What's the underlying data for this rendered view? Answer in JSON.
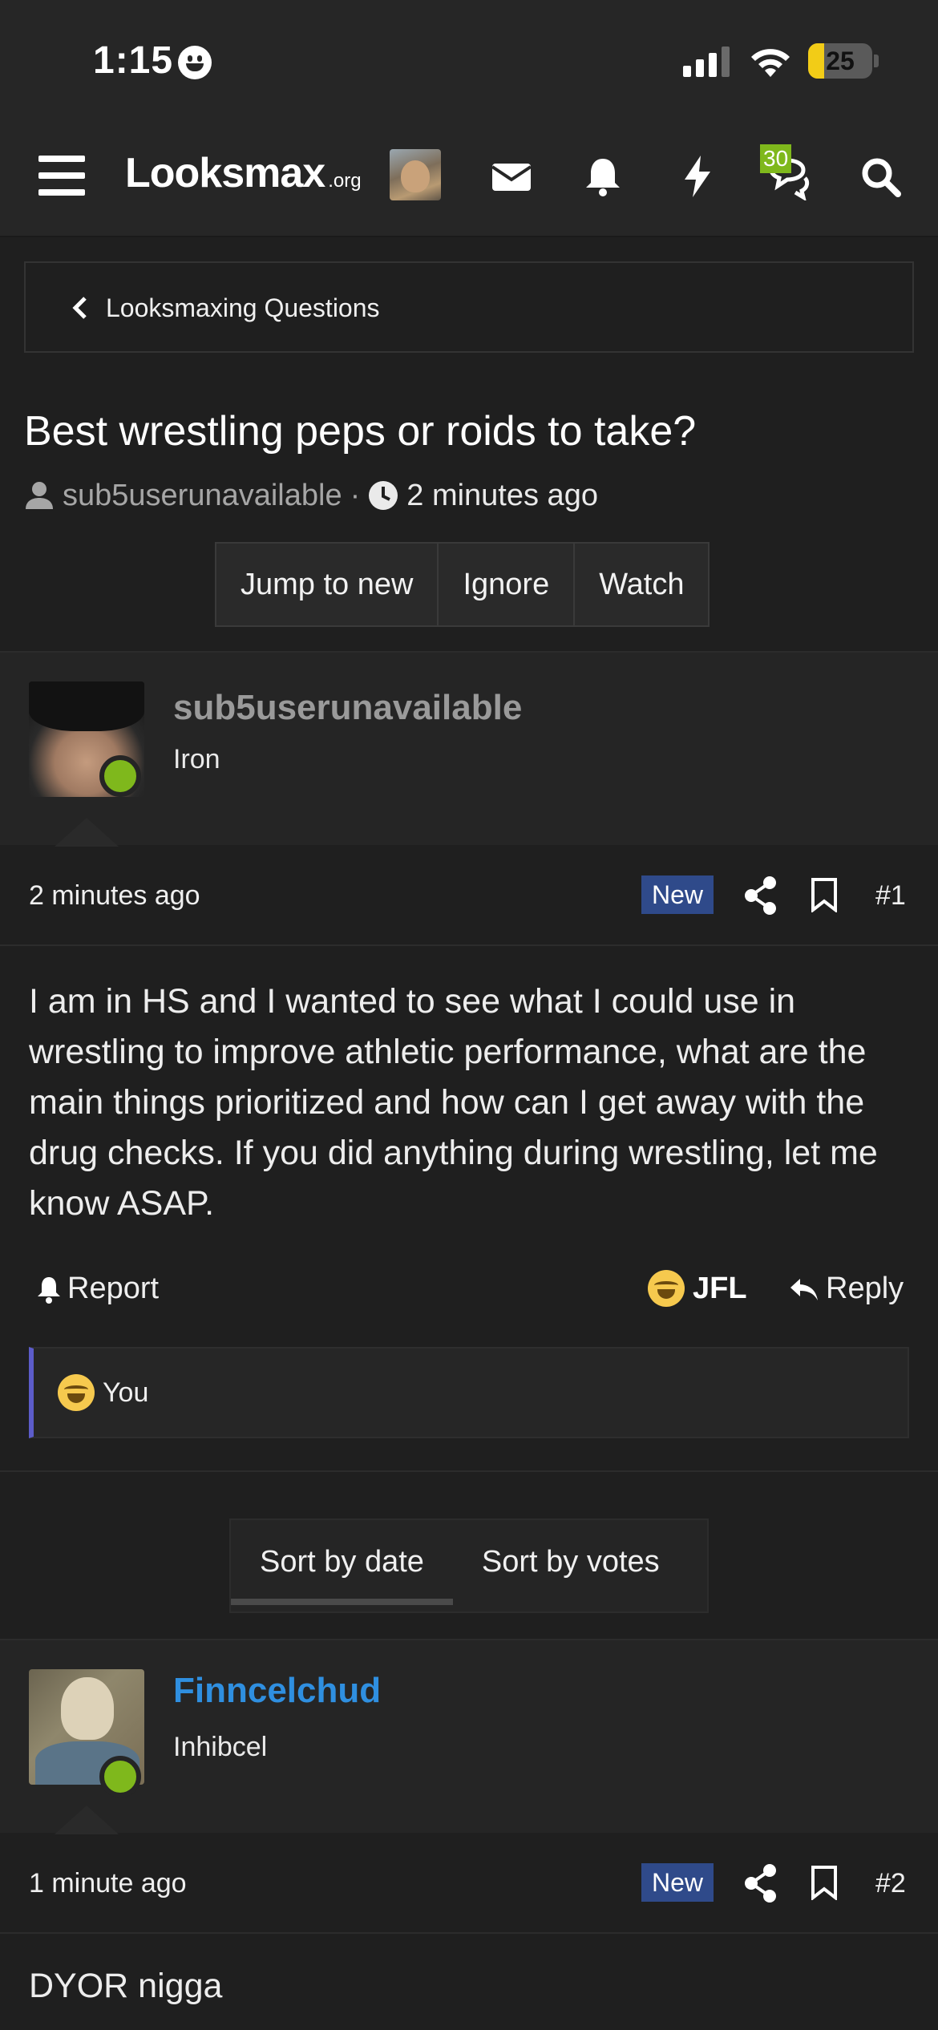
{
  "status_bar": {
    "time": "1:15",
    "battery": "25",
    "battery_fraction": 0.25
  },
  "nav": {
    "logo": "Looksmax",
    "logo_suffix": ".org",
    "chat_badge": "30",
    "icons": [
      "menu-icon",
      "envelope-icon",
      "bell-icon",
      "bolt-icon",
      "chat-icon",
      "search-icon"
    ]
  },
  "breadcrumb": {
    "label": "Looksmaxing Questions"
  },
  "thread": {
    "title": "Best wrestling peps or roids to take?",
    "author": "sub5userunavailable",
    "separator": "·",
    "time": "2 minutes ago",
    "buttons": {
      "jump": "Jump to new",
      "ignore": "Ignore",
      "watch": "Watch"
    }
  },
  "posts": [
    {
      "username": "sub5userunavailable",
      "username_color": "#9a9a9a",
      "user_title": "Iron",
      "time": "2 minutes ago",
      "badge": "New",
      "number": "#1",
      "body": "I am in HS and I wanted to see what I could use in wrestling to improve athletic performance, what are the main things prioritized and how can I get away with the drug checks. If you did anything during wrestling, let me know ASAP.",
      "actions": {
        "report": "Report",
        "reaction": "JFL",
        "reply": "Reply"
      },
      "reactions_summary": "You"
    },
    {
      "username": "Finncelchud",
      "username_color": "#2f8fe0",
      "user_title": "Inhibcel",
      "time": "1 minute ago",
      "badge": "New",
      "number": "#2",
      "body": "DYOR nigga"
    }
  ],
  "sort": {
    "by_date": "Sort by date",
    "by_votes": "Sort by votes",
    "active": "by_date"
  },
  "colors": {
    "accent_green": "#7fb81c",
    "new_badge": "#2f4a8a",
    "reaction_border": "#5c5cc9"
  }
}
